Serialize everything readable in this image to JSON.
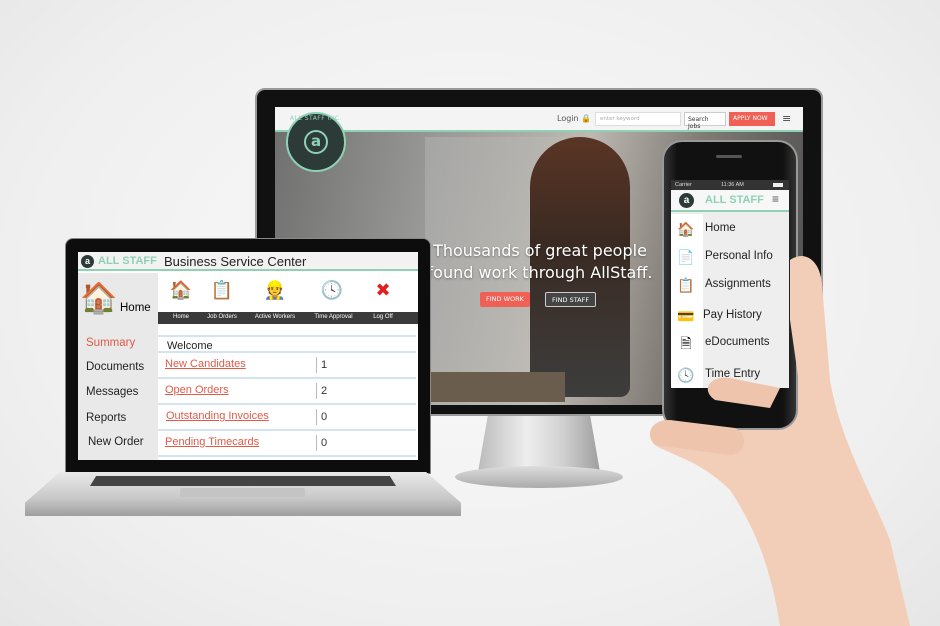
{
  "monitor": {
    "header": {
      "login": "Login",
      "lock_icon": "lock-icon",
      "search_placeholder": "enter keyword",
      "search_button": "Search Jobs",
      "apply_button": "APPLY NOW",
      "menu_icon": "hamburger-icon"
    },
    "logo": {
      "ring_text_top": "ALL STAFF INC.",
      "ring_text_bottom": "ALL STAFF INC.",
      "letter": "a"
    },
    "hero": {
      "line1": "Thousands of great people",
      "line2": "found work through AllStaff.",
      "find_work": "FIND WORK",
      "find_staff": "FIND STAFF"
    },
    "colors": {
      "accent": "#8fd1b5",
      "cta": "#f06055",
      "dark": "#2c3b38"
    }
  },
  "laptop": {
    "brand_letter": "a",
    "brand": "ALL STAFF",
    "title": "Business Service Center",
    "sidebar": {
      "home": "Home",
      "items": [
        "Summary",
        "Documents",
        "Messages",
        "Reports",
        "New Order"
      ],
      "active": "Summary"
    },
    "toolbar": [
      {
        "label": "Home",
        "icon": "house-icon"
      },
      {
        "label": "Job Orders",
        "icon": "clipboard-icon"
      },
      {
        "label": "Active Workers",
        "icon": "worker-icon"
      },
      {
        "label": "Time Approval",
        "icon": "clock-clipboard-icon"
      },
      {
        "label": "Log Off",
        "icon": "close-icon"
      }
    ],
    "welcome": "Welcome",
    "summary": [
      {
        "label": "New Candidates",
        "value": "1"
      },
      {
        "label": "Open Orders",
        "value": "2"
      },
      {
        "label": "Outstanding Invoices",
        "value": "0"
      },
      {
        "label": "Pending Timecards",
        "value": "0"
      }
    ]
  },
  "phone": {
    "status": {
      "carrier": "Carrier",
      "time": "11:36 AM"
    },
    "brand_letter": "a",
    "brand": "ALL STAFF",
    "menu": [
      {
        "label": "Home",
        "icon": "house-icon"
      },
      {
        "label": "Personal Info",
        "icon": "document-icon"
      },
      {
        "label": "Assignments",
        "icon": "clipboard-icon"
      },
      {
        "label": "Pay History",
        "icon": "check-icon"
      },
      {
        "label": "eDocuments",
        "icon": "edocument-icon"
      },
      {
        "label": "Time Entry",
        "icon": "clock-clipboard-icon"
      }
    ]
  }
}
